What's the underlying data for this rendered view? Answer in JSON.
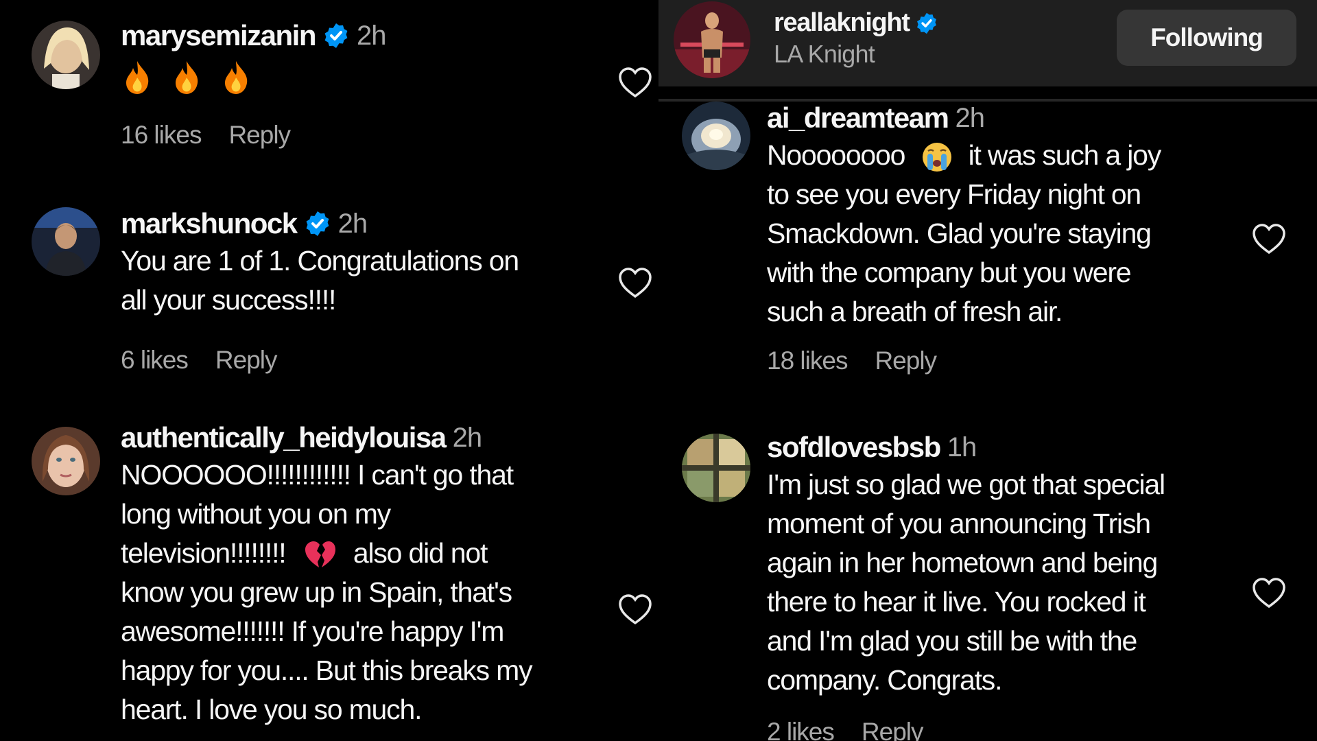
{
  "left_comments": [
    {
      "username": "marysemizanin",
      "verified": true,
      "time": "2h",
      "text_lines": [],
      "emoji": [
        "fire",
        "fire",
        "fire"
      ],
      "likes": "16 likes",
      "reply": "Reply"
    },
    {
      "username": "markshunock",
      "verified": true,
      "time": "2h",
      "text_lines": [
        "You are 1 of 1. Congratulations on",
        "all your success!!!!"
      ],
      "likes": "6 likes",
      "reply": "Reply"
    },
    {
      "username": "authentically_heidylouisa",
      "verified": false,
      "time": "2h",
      "text_lines": [
        "NOOOOOO!!!!!!!!!!!! I can't go that",
        "long without you on my",
        "television!!!!!!!!",
        "know you grew up in Spain, that's",
        "awesome!!!!!!! If you're happy I'm",
        "happy for you.... But this breaks my",
        "heart. I love you so much."
      ],
      "line3_suffix": "also did not",
      "line3_emoji": "broken-heart"
    }
  ],
  "post_header": {
    "username": "reallaknight",
    "verified": true,
    "subtitle": "LA Knight",
    "follow_label": "Following"
  },
  "right_comments": [
    {
      "username": "ai_dreamteam",
      "verified": false,
      "time": "2h",
      "first_line_start": "Noooooooo",
      "first_line_emoji": "crying-face",
      "first_line_end": "it was such a joy",
      "text_lines": [
        "to see you every Friday night on",
        "Smackdown. Glad you're staying",
        "with the company but you were",
        "such a breath of fresh air."
      ],
      "likes": "18 likes",
      "reply": "Reply"
    },
    {
      "username": "sofdlovesbsb",
      "verified": false,
      "time": "1h",
      "text_lines": [
        "I'm just so glad we got that special",
        "moment of you announcing Trish",
        "again in her hometown and being",
        "there to hear it live. You rocked it",
        "and I'm glad you still be with the",
        "company. Congrats."
      ],
      "likes": "2 likes",
      "reply": "Reply"
    }
  ],
  "colors": {
    "background": "#000000",
    "text": "#f5f5f5",
    "secondary_text": "#a8a8a8",
    "verified_blue": "#0095f6",
    "header_bg": "#1f1f1f",
    "button_bg": "#363636"
  }
}
